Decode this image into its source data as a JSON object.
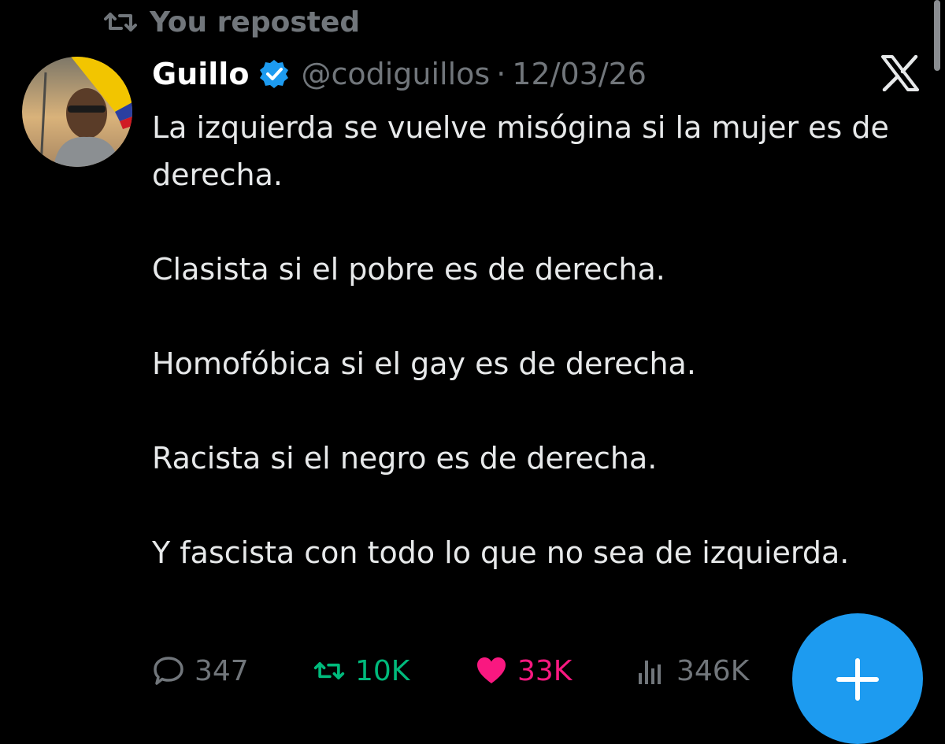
{
  "repost": {
    "label": "You reposted",
    "icon": "repost-icon",
    "color": "#71767b"
  },
  "author": {
    "name": "Guillo",
    "verified": true,
    "handle": "@codiguillos",
    "separator": "·",
    "date": "12/03/26",
    "avatar_icon": "profile-photo"
  },
  "source_logo": "x-logo",
  "tweet": {
    "paragraphs": [
      "La izquierda se vuelve misógina si la mujer es de derecha.",
      "Clasista si el pobre es de derecha.",
      "Homofóbica si el gay es de derecha.",
      "Racista si el negro es de derecha.",
      "Y fascista con todo lo que no sea de izquierda."
    ]
  },
  "actions": {
    "replies": "347",
    "reposts": "10K",
    "likes": "33K",
    "views": "346K"
  },
  "colors": {
    "background": "#000000",
    "text": "#e7e9ea",
    "muted": "#71767b",
    "repost_active": "#00ba7c",
    "like_active": "#f91880",
    "accent": "#1d9bf0"
  },
  "fab": {
    "icon": "plus-icon"
  }
}
